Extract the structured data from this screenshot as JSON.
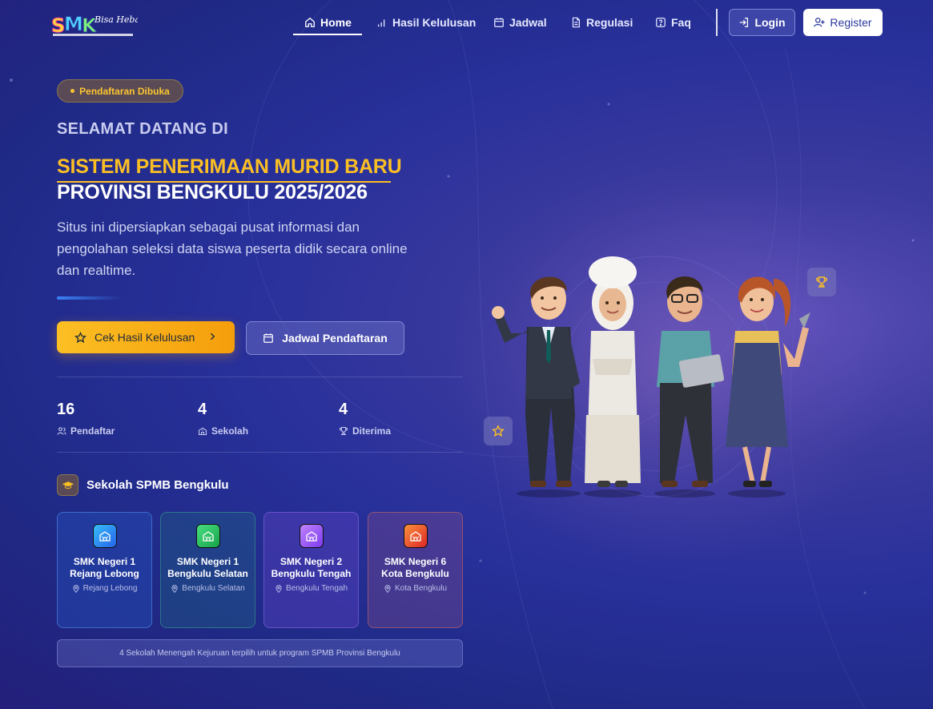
{
  "brand": {
    "logo_text": "SMK",
    "logo_script": "Bisa Hebat"
  },
  "nav": {
    "items": [
      {
        "label": "Home",
        "icon": "home-icon",
        "active": true
      },
      {
        "label": "Hasil Kelulusan",
        "icon": "bar-chart-icon"
      },
      {
        "label": "Jadwal",
        "icon": "calendar-icon"
      },
      {
        "label": "Regulasi",
        "icon": "document-icon"
      },
      {
        "label": "Faq",
        "icon": "help-icon"
      }
    ],
    "login_label": "Login",
    "register_label": "Register"
  },
  "hero": {
    "badge": "Pendaftaran Dibuka",
    "welcome": "SELAMAT DATANG DI",
    "title_line1": "SISTEM PENERIMAAN MURID BARU",
    "title_line2": "PROVINSI BENGKULU 2025/2026",
    "description": "Situs ini dipersiapkan sebagai pusat informasi dan pengolahan seleksi data siswa peserta didik secara online dan realtime.",
    "primary_button": "Cek Hasil Kelulusan",
    "secondary_button": "Jadwal Pendaftaran"
  },
  "stats": [
    {
      "value": "16",
      "label": "Pendaftar",
      "icon": "users-icon"
    },
    {
      "value": "4",
      "label": "Sekolah",
      "icon": "school-icon"
    },
    {
      "value": "4",
      "label": "Diterima",
      "icon": "trophy-icon"
    }
  ],
  "schools_section": {
    "title": "Sekolah SPMB Bengkulu",
    "schools": [
      {
        "name": "SMK Negeri 1 Rejang Lebong",
        "location": "Rejang Lebong",
        "color": "#2aa0e8"
      },
      {
        "name": "SMK Negeri 1 Bengkulu Selatan",
        "location": "Bengkulu Selatan",
        "color": "#22c55e"
      },
      {
        "name": "SMK Negeri 2 Bengkulu Tengah",
        "location": "Bengkulu Tengah",
        "color": "#a855f7"
      },
      {
        "name": "SMK Negeri 6 Kota Bengkulu",
        "location": "Kota Bengkulu",
        "color": "#f97316"
      }
    ],
    "footer_note": "4 Sekolah Menengah Kejuruan terpilih untuk program SPMB Provinsi Bengkulu"
  },
  "colors": {
    "accent": "#fbbf24",
    "primary": "#28309a",
    "badge_text": "#fbc531"
  }
}
